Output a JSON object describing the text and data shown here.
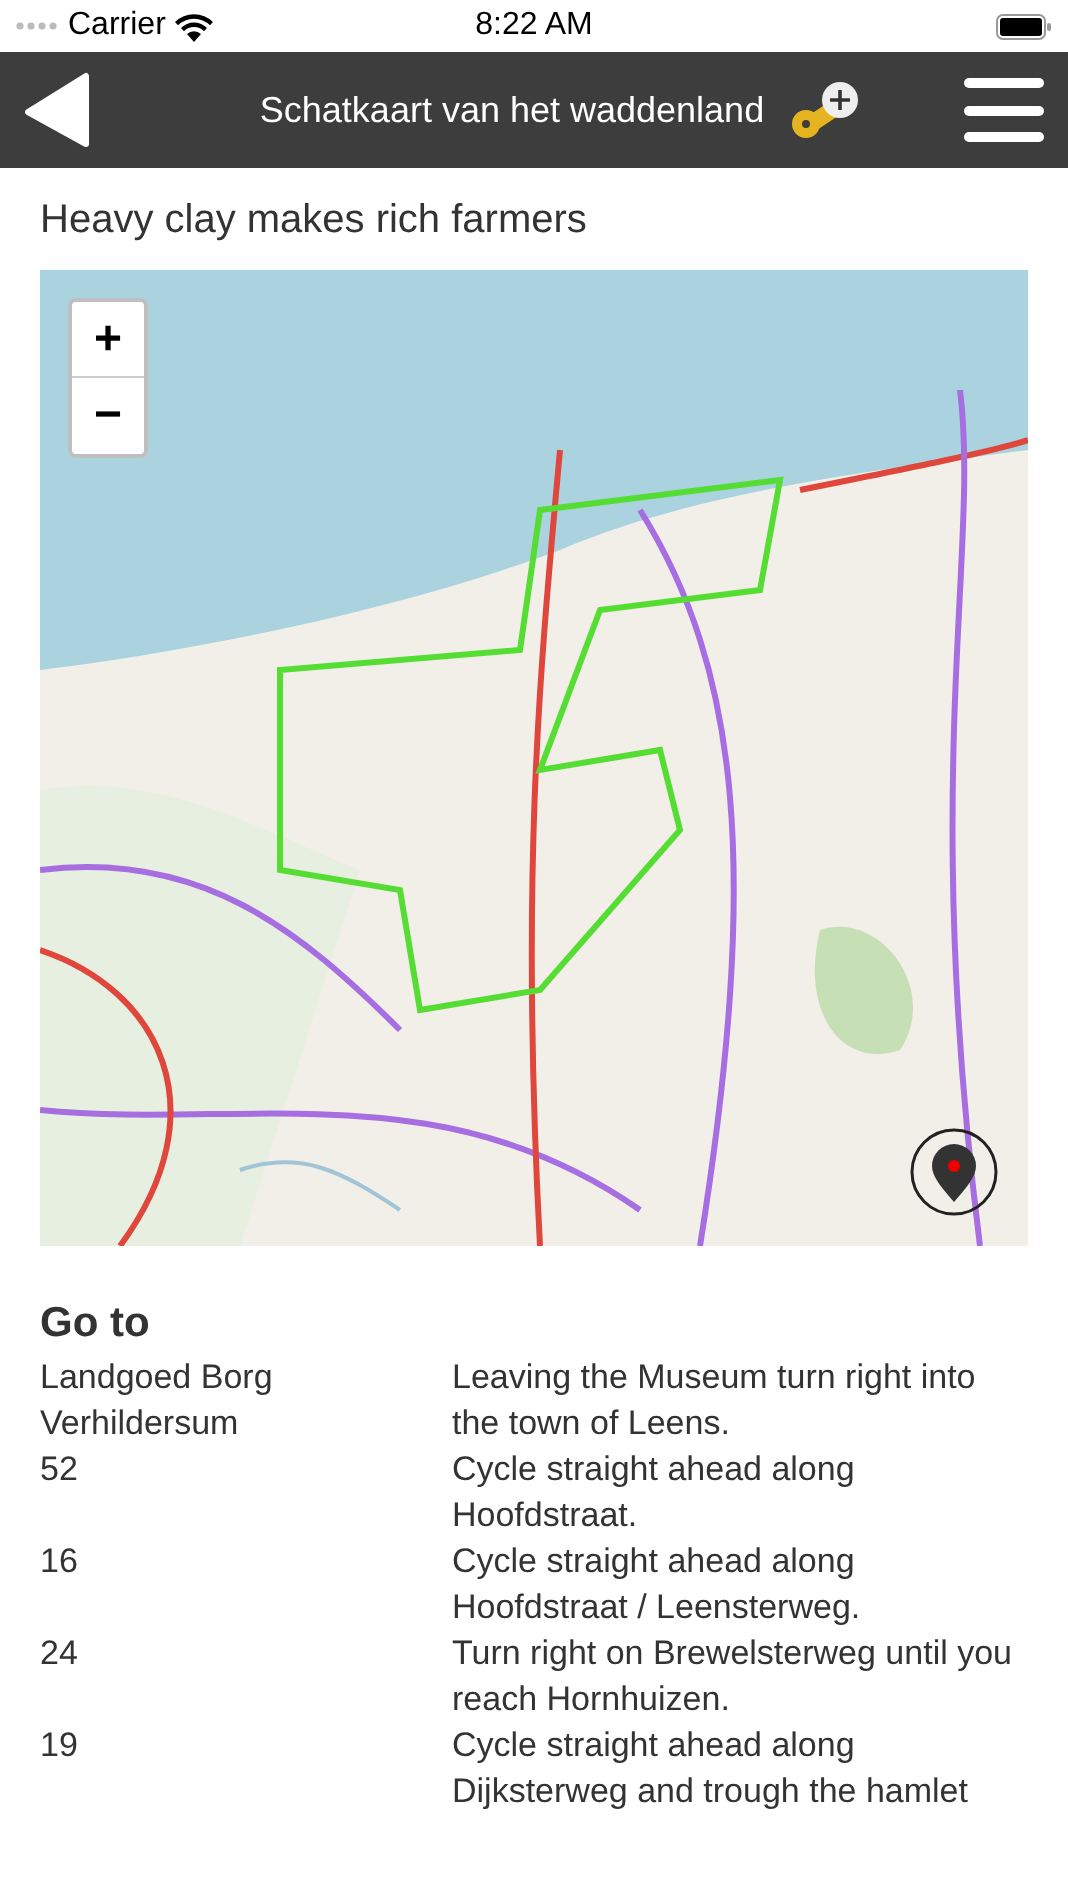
{
  "status_bar": {
    "carrier": "Carrier",
    "time": "8:22 AM"
  },
  "nav_bar": {
    "title": "Schatkaart van het waddenland"
  },
  "heading": "Heavy clay makes rich farmers",
  "map": {
    "kind": "picture",
    "zoom_in": "+",
    "zoom_out": "−"
  },
  "directions": {
    "title": "Go to",
    "rows": [
      {
        "place": "Landgoed Borg Verhildersum",
        "instruction": "Leaving the Museum turn right into the town of Leens."
      },
      {
        "place": "52",
        "instruction": "Cycle straight ahead along Hoofdstraat."
      },
      {
        "place": "16",
        "instruction": "Cycle straight ahead along Hoofdstraat / Leensterweg."
      },
      {
        "place": "24",
        "instruction": "Turn right on Brewelsterweg until you reach Hornhuizen."
      },
      {
        "place": "19",
        "instruction": "Cycle straight ahead along Dijksterweg and trough the hamlet"
      }
    ]
  }
}
